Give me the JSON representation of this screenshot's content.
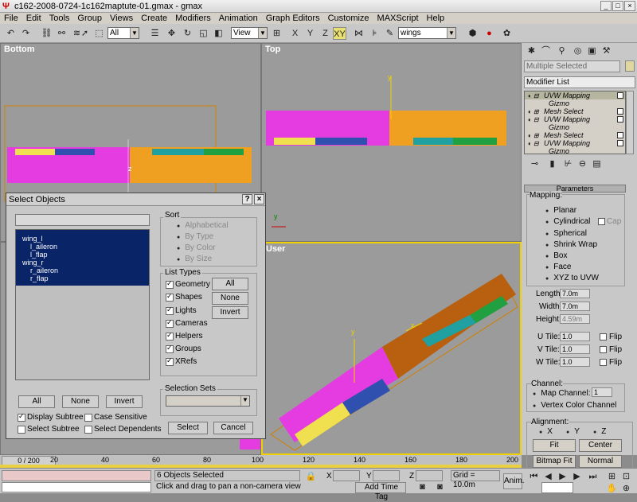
{
  "window": {
    "title": "c162-2008-0724-1c162maptute-01.gmax - gmax",
    "app_icon": "gmax-logo-icon",
    "buttons": [
      "_",
      "□",
      "×"
    ]
  },
  "menu": [
    "File",
    "Edit",
    "Tools",
    "Group",
    "Views",
    "Create",
    "Modifiers",
    "Animation",
    "Graph Editors",
    "Customize",
    "MAXScript",
    "Help"
  ],
  "toolbar": {
    "selection_filter": "All",
    "coord_system": "View",
    "axis_x": "X",
    "axis_y": "Y",
    "axis_z": "Z",
    "axis_xy": "XY",
    "named_selection": "wings"
  },
  "viewports": {
    "bottom": "Bottom",
    "top": "Top",
    "user": "User"
  },
  "command_panel": {
    "object_name": "Multiple Selected",
    "modifier_list": "Modifier List",
    "stack": [
      {
        "label": "UVW Mapping",
        "selected": true,
        "indent": false
      },
      {
        "label": "Gizmo",
        "selected": false,
        "indent": true
      },
      {
        "label": "Mesh Select",
        "selected": false,
        "indent": false
      },
      {
        "label": "UVW Mapping",
        "selected": false,
        "indent": false
      },
      {
        "label": "Gizmo",
        "selected": false,
        "indent": true
      },
      {
        "label": "Mesh Select",
        "selected": false,
        "indent": false
      },
      {
        "label": "UVW Mapping",
        "selected": false,
        "indent": false
      },
      {
        "label": "Gizmo",
        "selected": false,
        "indent": true
      }
    ],
    "rollout_title": "Parameters",
    "mapping_label": "Mapping:",
    "mapping_options": [
      "Planar",
      "Cylindrical",
      "Spherical",
      "Shrink Wrap",
      "Box",
      "Face",
      "XYZ to UVW"
    ],
    "cap_label": "Cap",
    "length_label": "Length:",
    "length_value": "7.0m",
    "width_label": "Width:",
    "width_value": "7.0m",
    "height_label": "Height:",
    "height_value": "4.59m",
    "utile_label": "U Tile:",
    "utile_value": "1.0",
    "vtile_label": "V Tile:",
    "vtile_value": "1.0",
    "wtile_label": "W Tile:",
    "wtile_value": "1.0",
    "flip_label": "Flip",
    "channel_label": "Channel:",
    "map_channel_label": "Map Channel:",
    "map_channel_value": "1",
    "vertex_color_label": "Vertex Color Channel",
    "alignment_label": "Alignment:",
    "align_x": "X",
    "align_y": "Y",
    "align_z": "Z",
    "fit_label": "Fit",
    "center_label": "Center",
    "bitmap_fit_label": "Bitmap Fit",
    "normal_align_label": "Normal Align"
  },
  "dialog": {
    "title": "Select Objects",
    "help": "?",
    "close": "×",
    "objects": [
      "wing_l",
      "l_aileron",
      "l_flap",
      "wing_r",
      "r_aileron",
      "r_flap"
    ],
    "object_indent": [
      false,
      true,
      true,
      false,
      true,
      true
    ],
    "all_label": "All",
    "none_label": "None",
    "invert_label": "Invert",
    "display_subtree": "Display Subtree",
    "case_sensitive": "Case Sensitive",
    "select_subtree": "Select Subtree",
    "select_dependents": "Select Dependents",
    "sort_title": "Sort",
    "sort_options": [
      "Alphabetical",
      "By Type",
      "By Color",
      "By Size"
    ],
    "list_types_title": "List Types",
    "list_types": [
      "Geometry",
      "Shapes",
      "Lights",
      "Cameras",
      "Helpers",
      "Groups",
      "XRefs"
    ],
    "lt_all": "All",
    "lt_none": "None",
    "lt_invert": "Invert",
    "selection_sets_title": "Selection Sets",
    "select_button": "Select",
    "cancel_button": "Cancel"
  },
  "timeline": {
    "frame": "0 / 200",
    "ticks": [
      "20",
      "40",
      "60",
      "80",
      "100",
      "120",
      "140",
      "160",
      "180",
      "200"
    ]
  },
  "status": {
    "selected": "6 Objects Selected",
    "prompt": "Click and drag to pan a non-camera view",
    "x_label": "X",
    "y_label": "Y",
    "z_label": "Z",
    "grid": "Grid = 10.0m",
    "add_time_tag": "Add Time Tag",
    "anim_label": "Anim."
  },
  "colors": {
    "magenta": "#e43ce0",
    "orange": "#f0a020",
    "selection_blue": "#0a2468",
    "viewport_bg": "#9b9b9b",
    "active_border": "#f0d000"
  }
}
